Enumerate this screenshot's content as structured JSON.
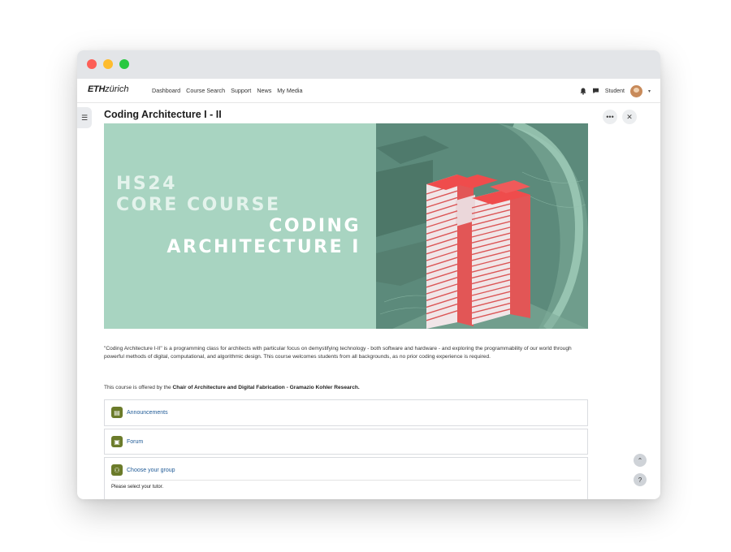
{
  "window": {
    "traffic_lights": [
      "close",
      "minimize",
      "zoom"
    ]
  },
  "navbar": {
    "logo_eth": "ETH",
    "logo_zurich": "zürich",
    "links": [
      "Dashboard",
      "Course Search",
      "Support",
      "News",
      "My Media"
    ],
    "user_label": "Student"
  },
  "page": {
    "title": "Coding Architecture I - II",
    "more_icon": "•••",
    "close_icon": "✕"
  },
  "banner": {
    "line1": "HS24",
    "line2": "CORE COURSE",
    "line3": "CODING",
    "line4": "ARCHITECTURE I"
  },
  "description": "\"Coding Architecture I-II\" is a programming class for architects with particular focus on demystifying technology - both software and hardware - and exploring the programmability of our world through powerful methods of digital, computational, and algorithmic design. This course welcomes students from all backgrounds, as no prior coding experience is required.",
  "offered": {
    "prefix": "This course is offered by the ",
    "chair": "Chair of Architecture and Digital Fabrication - Gramazio Kohler Research."
  },
  "activities": [
    {
      "label": "Announcements",
      "icon": "announcement-icon"
    },
    {
      "label": "Forum",
      "icon": "forum-icon"
    },
    {
      "label": "Choose your group",
      "icon": "group-icon",
      "sub": "Please select your tutor."
    }
  ],
  "colors": {
    "banner_bg": "#a8d4c1",
    "link": "#1f5a96",
    "activity_icon": "#6b7b2a",
    "tower": "#e65a5a"
  }
}
